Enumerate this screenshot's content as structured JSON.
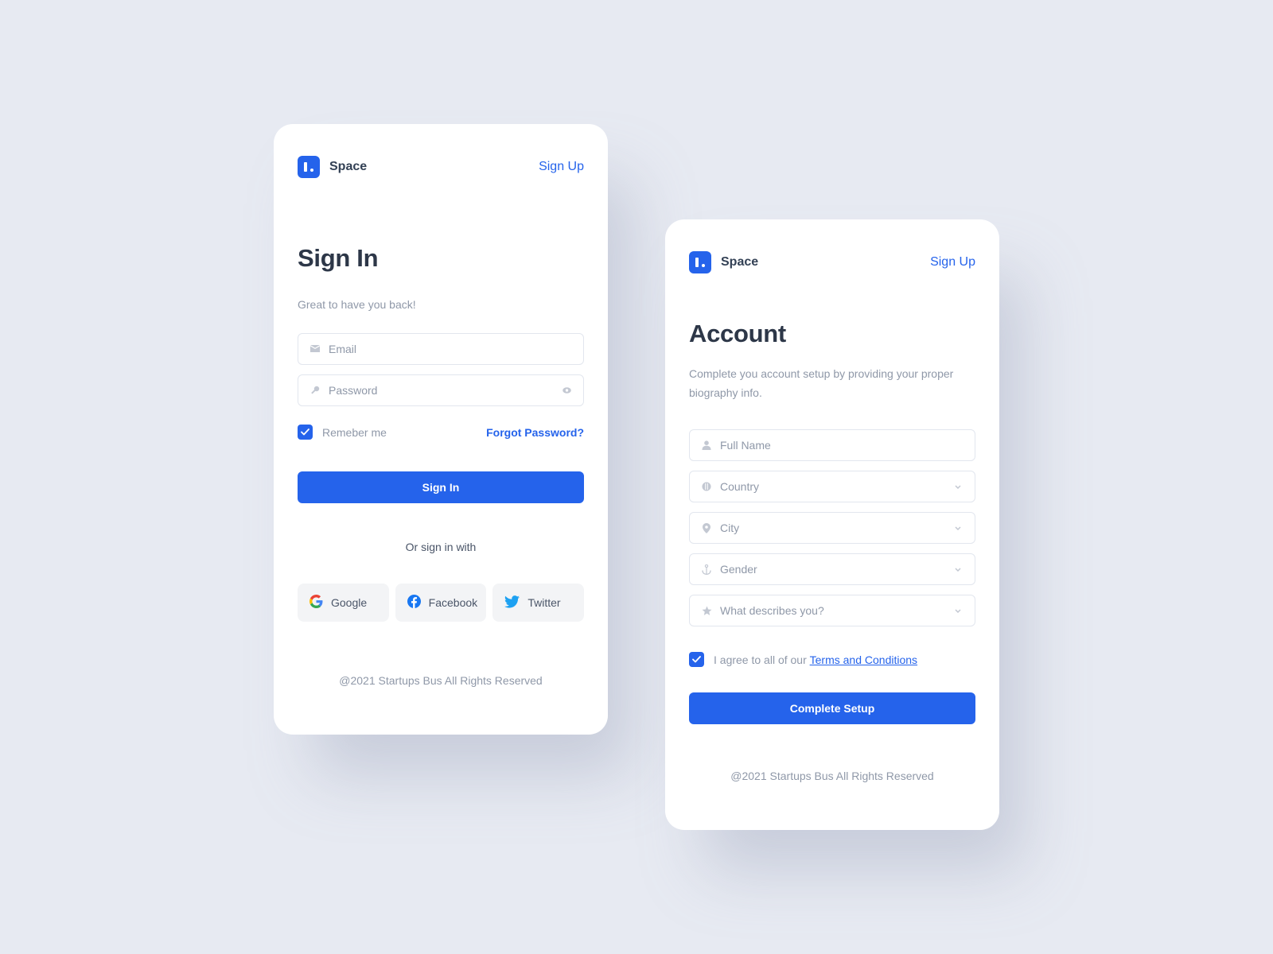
{
  "colors": {
    "background": "#e7eaf2",
    "accent": "#2563eb",
    "heading": "#2d3748",
    "muted": "#8f98a8"
  },
  "signin_card": {
    "brand": {
      "name": "Space",
      "logo_icon": "space-logo-icon"
    },
    "signup_link": "Sign Up",
    "title": "Sign In",
    "subtitle": "Great to have you back!",
    "fields": [
      {
        "icon": "mail-icon",
        "placeholder": "Email",
        "value": ""
      },
      {
        "icon": "key-icon",
        "placeholder": "Password",
        "value": "",
        "trailing_icon": "eye-icon"
      }
    ],
    "remember": {
      "label": "Remeber me",
      "checked": true
    },
    "forgot_link": "Forgot Password?",
    "submit_label": "Sign In",
    "divider_text": "Or sign in with",
    "social": [
      {
        "label": "Google",
        "icon": "google-icon"
      },
      {
        "label": "Facebook",
        "icon": "facebook-icon"
      },
      {
        "label": "Twitter",
        "icon": "twitter-icon"
      }
    ],
    "footer": "@2021 Startups Bus All Rights Reserved"
  },
  "account_card": {
    "brand": {
      "name": "Space",
      "logo_icon": "space-logo-icon"
    },
    "signup_link": "Sign Up",
    "title": "Account",
    "subtitle": "Complete you account setup by providing your proper biography info.",
    "fields": [
      {
        "icon": "user-icon",
        "placeholder": "Full Name",
        "type": "text"
      },
      {
        "icon": "globe-icon",
        "placeholder": "Country",
        "type": "select"
      },
      {
        "icon": "map-pin-icon",
        "placeholder": "City",
        "type": "select"
      },
      {
        "icon": "anchor-icon",
        "placeholder": "Gender",
        "type": "select"
      },
      {
        "icon": "star-icon",
        "placeholder": "What describes you?",
        "type": "select"
      }
    ],
    "terms": {
      "checked": true,
      "prefix": "I agree to all of our",
      "link": "Terms and Conditions"
    },
    "submit_label": "Complete Setup",
    "footer": "@2021 Startups Bus All Rights Reserved"
  }
}
